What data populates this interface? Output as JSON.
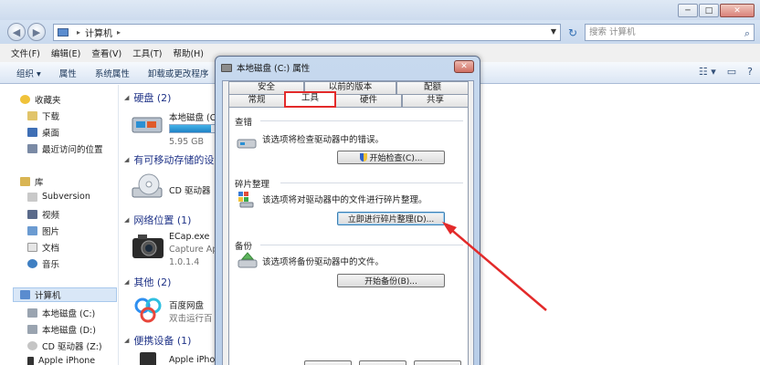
{
  "window": {
    "caption_buttons": {
      "minimize": "─",
      "maximize": "□",
      "close": "✕"
    },
    "address": {
      "root_sep": "▸",
      "location": "计算机",
      "sep": "▸"
    },
    "search": {
      "placeholder": "搜索 计算机"
    }
  },
  "menu": [
    "文件(F)",
    "编辑(E)",
    "查看(V)",
    "工具(T)",
    "帮助(H)"
  ],
  "toolbar": {
    "organize": "组织 ▾",
    "properties": "属性",
    "system_properties": "系统属性",
    "uninstall": "卸载或更改程序"
  },
  "sidebar": {
    "favorites_label": "收藏夹",
    "favorites": [
      "下载",
      "桌面",
      "最近访问的位置"
    ],
    "libraries_label": "库",
    "libraries": [
      "Subversion",
      "视频",
      "图片",
      "文档",
      "音乐"
    ],
    "computer_label": "计算机",
    "computer_items": [
      "本地磁盘 (C:)",
      "本地磁盘 (D:)",
      "CD 驱动器 (Z:)",
      "Apple iPhone"
    ]
  },
  "main": {
    "groups": {
      "hard_disk": "硬盘 (2)",
      "removable": "有可移动存储的设",
      "network": "网络位置 (1)",
      "other": "其他 (2)",
      "portable": "便携设备 (1)"
    },
    "items": {
      "disk_c": {
        "name": "本地磁盘 (C",
        "free": "5.95 GB",
        "used_fraction": 0.9
      },
      "cd": {
        "name": "CD 驱动器"
      },
      "ecap": {
        "name": "ECap.exe",
        "line2": "Capture Ap",
        "line3": "1.0.1.4"
      },
      "baidu": {
        "name": "百度网盘",
        "line2": "双击运行百"
      },
      "iphone": {
        "name": "Apple iPho"
      }
    }
  },
  "dialog": {
    "title": "本地磁盘 (C:) 属性",
    "close": "✕",
    "tabs_row1": [
      "安全",
      "以前的版本",
      "配额"
    ],
    "tabs_row2": [
      "常规",
      "工具",
      "硬件",
      "共享"
    ],
    "active_tab": "工具",
    "sections": {
      "check": {
        "title": "查错",
        "desc": "该选项将检查驱动器中的错误。",
        "button": "开始检查(C)..."
      },
      "defrag": {
        "title": "碎片整理",
        "desc": "该选项将对驱动器中的文件进行碎片整理。",
        "button": "立即进行碎片整理(D)..."
      },
      "backup": {
        "title": "备份",
        "desc": "该选项将备份驱动器中的文件。",
        "button": "开始备份(B)..."
      }
    }
  },
  "colors": {
    "accent": "#1e3287",
    "annotation": "#e32a2a",
    "selection": "#d9e7f7"
  }
}
